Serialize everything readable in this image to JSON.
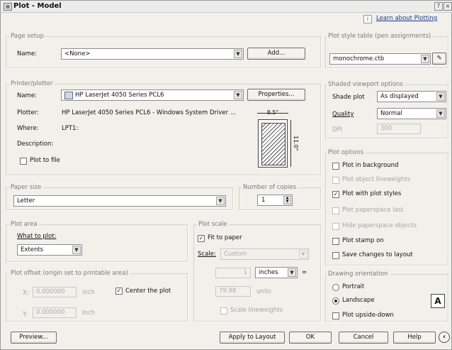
{
  "window": {
    "title": "Plot - Model"
  },
  "help_link": {
    "label": "Learn about Plotting"
  },
  "page_setup": {
    "legend": "Page setup",
    "name_label": "Name:",
    "name_value": "<None>",
    "add_label": "Add..."
  },
  "printer": {
    "legend": "Printer/plotter",
    "name_label": "Name:",
    "name_value": "HP LaserJet 4050 Series PCL6",
    "properties_label": "Properties...",
    "plotter_label": "Plotter:",
    "plotter_value": "HP LaserJet 4050 Series PCL6 - Windows System Driver ...",
    "where_label": "Where:",
    "where_value": "LPT1:",
    "description_label": "Description:",
    "plot_to_file_label": "Plot to file",
    "preview_width": "8.5\"",
    "preview_height": "11.0\""
  },
  "paper_size": {
    "legend": "Paper size",
    "value": "Letter"
  },
  "copies": {
    "legend": "Number of copies",
    "value": "1"
  },
  "plot_area": {
    "legend": "Plot area",
    "what_label": "What to plot:",
    "what_value": "Extents"
  },
  "plot_scale": {
    "legend": "Plot scale",
    "fit_label": "Fit to paper",
    "scale_label": "Scale:",
    "scale_value": "Custom",
    "value1": "1",
    "unit": "inches",
    "value2": "79.98",
    "unit2": "units",
    "lineweights_label": "Scale lineweights"
  },
  "plot_offset": {
    "legend": "Plot offset (origin set to printable area)",
    "x_label": "X:",
    "x_value": "0.000000",
    "x_unit": "inch",
    "y_label": "Y:",
    "y_value": "0.000000",
    "y_unit": "inch",
    "center_label": "Center the plot"
  },
  "plot_style_table": {
    "legend": "Plot style table (pen assignments)",
    "value": "monochrome.ctb"
  },
  "shaded_viewport": {
    "legend": "Shaded viewport options",
    "shade_label": "Shade plot",
    "shade_value": "As displayed",
    "quality_label": "Quality",
    "quality_value": "Normal",
    "dpi_label": "DPI",
    "dpi_value": "300"
  },
  "plot_options": {
    "legend": "Plot options",
    "background": "Plot in background",
    "lineweights": "Plot object lineweights",
    "plot_styles": "Plot with plot styles",
    "paperspace_last": "Plot paperspace last",
    "hide_paperspace": "Hide paperspace objects",
    "stamp": "Plot stamp on",
    "save_changes": "Save changes to layout"
  },
  "orientation": {
    "legend": "Drawing orientation",
    "portrait": "Portrait",
    "landscape": "Landscape",
    "upside_down": "Plot upside-down"
  },
  "footer": {
    "preview": "Preview...",
    "apply": "Apply to Layout",
    "ok": "OK",
    "cancel": "Cancel",
    "help": "Help"
  }
}
